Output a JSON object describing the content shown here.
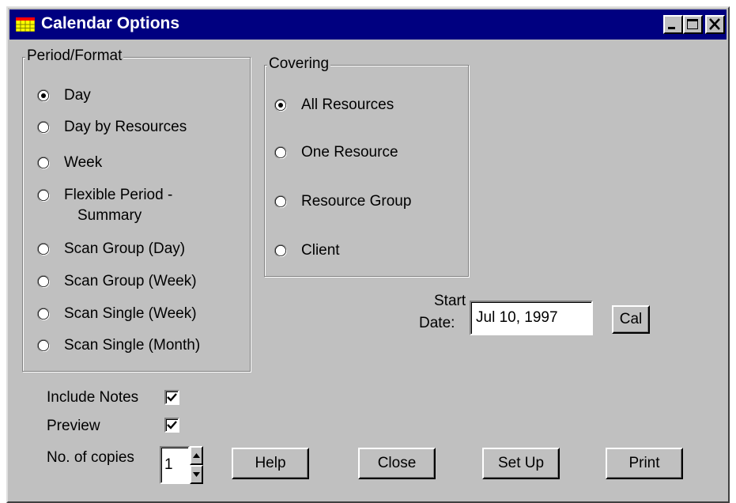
{
  "window": {
    "title": "Calendar Options",
    "controls": [
      "minimize-icon",
      "maximize-icon",
      "close-icon"
    ],
    "title_bar_color": "#000080",
    "face_color": "#c0c0c0"
  },
  "period_format": {
    "title": "Period/Format",
    "options": [
      {
        "label": "Day",
        "selected": true
      },
      {
        "label": "Day by Resources",
        "selected": false
      },
      {
        "label": "Week",
        "selected": false
      },
      {
        "label": "Flexible Period -",
        "label2": "Summary",
        "selected": false
      },
      {
        "label": "Scan Group (Day)",
        "selected": false
      },
      {
        "label": "Scan Group (Week)",
        "selected": false
      },
      {
        "label": "Scan Single (Week)",
        "selected": false
      },
      {
        "label": "Scan Single (Month)",
        "selected": false
      }
    ]
  },
  "covering": {
    "title": "Covering",
    "options": [
      {
        "label": "All Resources",
        "selected": true
      },
      {
        "label": "One Resource",
        "selected": false
      },
      {
        "label": "Resource Group",
        "selected": false
      },
      {
        "label": "Client",
        "selected": false
      }
    ]
  },
  "start_date": {
    "label_line1": "Start",
    "label_line2": "Date:",
    "value": "Jul 10, 1997",
    "cal_button": "Cal"
  },
  "options": {
    "include_notes_label": "Include Notes",
    "include_notes_checked": true,
    "preview_label": "Preview",
    "preview_checked": true,
    "copies_label": "No. of copies",
    "copies_value": "1"
  },
  "buttons": {
    "help": "Help",
    "close": "Close",
    "setup": "Set Up",
    "print": "Print"
  }
}
